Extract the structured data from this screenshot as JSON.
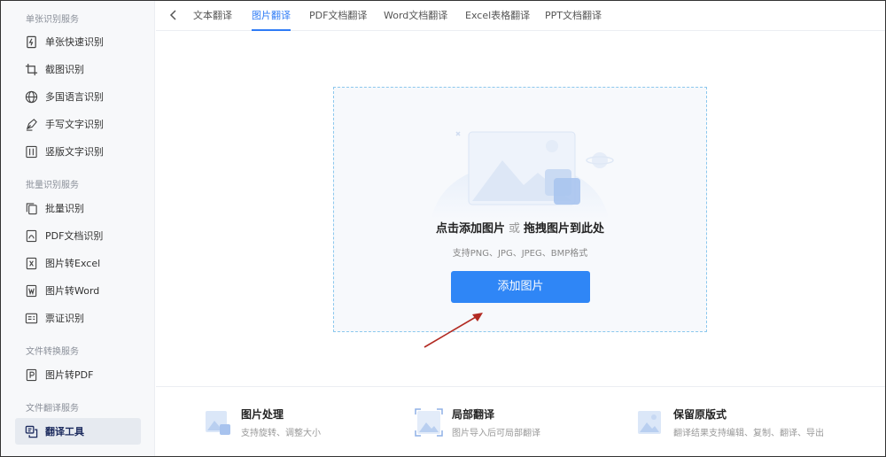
{
  "sidebar": {
    "sections": [
      {
        "title": "单张识别服务"
      },
      {
        "title": "批量识别服务"
      },
      {
        "title": "文件转换服务"
      },
      {
        "title": "文件翻译服务"
      }
    ],
    "items": [
      {
        "label": "单张快速识别",
        "icon": "lightning-doc-icon"
      },
      {
        "label": "截图识别",
        "icon": "crop-icon"
      },
      {
        "label": "多国语言识别",
        "icon": "globe-icon"
      },
      {
        "label": "手写文字识别",
        "icon": "pen-icon"
      },
      {
        "label": "竖版文字识别",
        "icon": "vertical-text-icon"
      },
      {
        "label": "批量识别",
        "icon": "stack-icon"
      },
      {
        "label": "PDF文档识别",
        "icon": "pdf-icon"
      },
      {
        "label": "图片转Excel",
        "icon": "excel-icon"
      },
      {
        "label": "图片转Word",
        "icon": "word-icon"
      },
      {
        "label": "票证识别",
        "icon": "ticket-icon"
      },
      {
        "label": "图片转PDF",
        "icon": "p-doc-icon"
      },
      {
        "label": "翻译工具",
        "icon": "translate-icon",
        "active": true
      }
    ]
  },
  "tabs": [
    {
      "label": "文本翻译"
    },
    {
      "label": "图片翻译",
      "active": true
    },
    {
      "label": "PDF文档翻译"
    },
    {
      "label": "Word文档翻译"
    },
    {
      "label": "Excel表格翻译"
    },
    {
      "label": "PPT文档翻译"
    }
  ],
  "upload": {
    "primary_a": "点击添加图片",
    "or": "或",
    "primary_b": "拖拽图片到此处",
    "formats": "支持PNG、JPG、JPEG、BMP格式",
    "button": "添加图片"
  },
  "features": [
    {
      "title": "图片处理",
      "desc": "支持旋转、调整大小",
      "icon": "image-edit-icon"
    },
    {
      "title": "局部翻译",
      "desc": "图片导入后可局部翻译",
      "icon": "image-crop-icon"
    },
    {
      "title": "保留原版式",
      "desc": "翻译结果支持编辑、复制、翻译、导出",
      "icon": "image-layout-icon"
    }
  ],
  "colors": {
    "accent": "#2f86f6",
    "dashed_border": "#8cc8ee",
    "annotation_arrow": "#b22a22"
  }
}
